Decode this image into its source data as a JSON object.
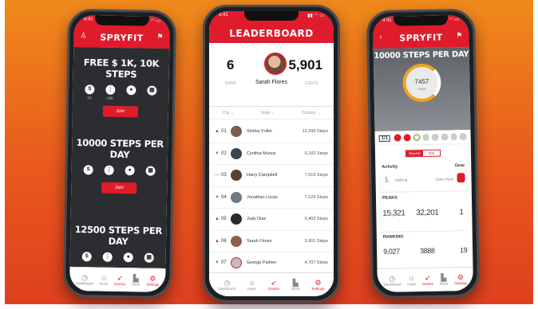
{
  "colors": {
    "brand": "#e01b2c",
    "up": "#e01b2c",
    "down": "#3cae3c",
    "same": "#4b5bd6"
  },
  "status_time": "9:41",
  "phone1": {
    "app_title": "SPRYFIT",
    "challenges": [
      {
        "title": "FREE $ 1K, 10K STEPS",
        "join": "Join",
        "stats": [
          {
            "icon": "dollar-icon",
            "glyph": "$",
            "value": "1K"
          },
          {
            "icon": "steps-icon",
            "glyph": "⋮",
            "value": "10K"
          },
          {
            "icon": "users-icon",
            "glyph": "●",
            "value": ""
          },
          {
            "icon": "calendar-icon",
            "glyph": "▦",
            "value": ""
          }
        ]
      },
      {
        "title": "10000 STEPS PER DAY",
        "join": "Join",
        "stats": [
          {
            "icon": "dollar-icon",
            "glyph": "$",
            "value": ""
          },
          {
            "icon": "steps-icon",
            "glyph": "⋮",
            "value": ""
          },
          {
            "icon": "users-icon",
            "glyph": "●",
            "value": ""
          },
          {
            "icon": "calendar-icon",
            "glyph": "▦",
            "value": ""
          }
        ]
      },
      {
        "title": "12500 STEPS PER DAY",
        "join": "",
        "stats": [
          {
            "icon": "dollar-icon",
            "glyph": "$",
            "value": ""
          },
          {
            "icon": "steps-icon",
            "glyph": "⋮",
            "value": ""
          },
          {
            "icon": "users-icon",
            "glyph": "●",
            "value": ""
          },
          {
            "icon": "calendar-icon",
            "glyph": "▦",
            "value": ""
          }
        ]
      }
    ]
  },
  "tabs": [
    {
      "name": "dashboard",
      "label": "Dashboard",
      "glyph": "◷"
    },
    {
      "name": "invite",
      "label": "Invite",
      "glyph": "☺"
    },
    {
      "name": "games",
      "label": "Games",
      "glyph": "➶"
    },
    {
      "name": "store",
      "label": "Store",
      "glyph": "▙"
    },
    {
      "name": "settings",
      "label": "Settings",
      "glyph": "⚙"
    }
  ],
  "phone2": {
    "title": "LEADERBOARD",
    "rank": "6",
    "rank_label": "RANK",
    "user_name": "Sarah Flores",
    "steps": "5,901",
    "steps_label": "STEPS",
    "filters": [
      "City",
      "State",
      "Country"
    ],
    "rows": [
      {
        "trend": "up",
        "rank": "01",
        "name": "Shirley Fuller",
        "steps": "12,299 Steps"
      },
      {
        "trend": "down",
        "rank": "02",
        "name": "Cynthia Munoz",
        "steps": "9,182 Steps"
      },
      {
        "trend": "same",
        "rank": "03",
        "name": "Harry Campbell",
        "steps": "7,919 Steps"
      },
      {
        "trend": "down",
        "rank": "04",
        "name": "Jonathan Lucas",
        "steps": "7,129 Steps"
      },
      {
        "trend": "up",
        "rank": "05",
        "name": "Judy Diaz",
        "steps": "6,409 Steps"
      },
      {
        "trend": "up",
        "rank": "06",
        "name": "Sarah Flores",
        "steps": "5,901 Steps"
      },
      {
        "trend": "down",
        "rank": "07",
        "name": "George Palmer",
        "steps": "4,707 Steps"
      }
    ]
  },
  "phone3": {
    "app_title": "SPRYFIT",
    "challenge_title": "10000 STEPS PER DAY",
    "ring_value": "7457",
    "ring_label": "Steps",
    "day_counter": "1/1",
    "segments": [
      "Recent",
      "Info"
    ],
    "activity_label": "Activity",
    "activity_value": "Walking",
    "gear_label": "Gear",
    "gear_value": "Video Wear",
    "peaks_label": "PEAKS",
    "peaks": [
      "15,321",
      "32,201",
      "1"
    ],
    "ranking_label": "RANKING",
    "ranking": [
      "9,027",
      "3888",
      "19"
    ]
  }
}
